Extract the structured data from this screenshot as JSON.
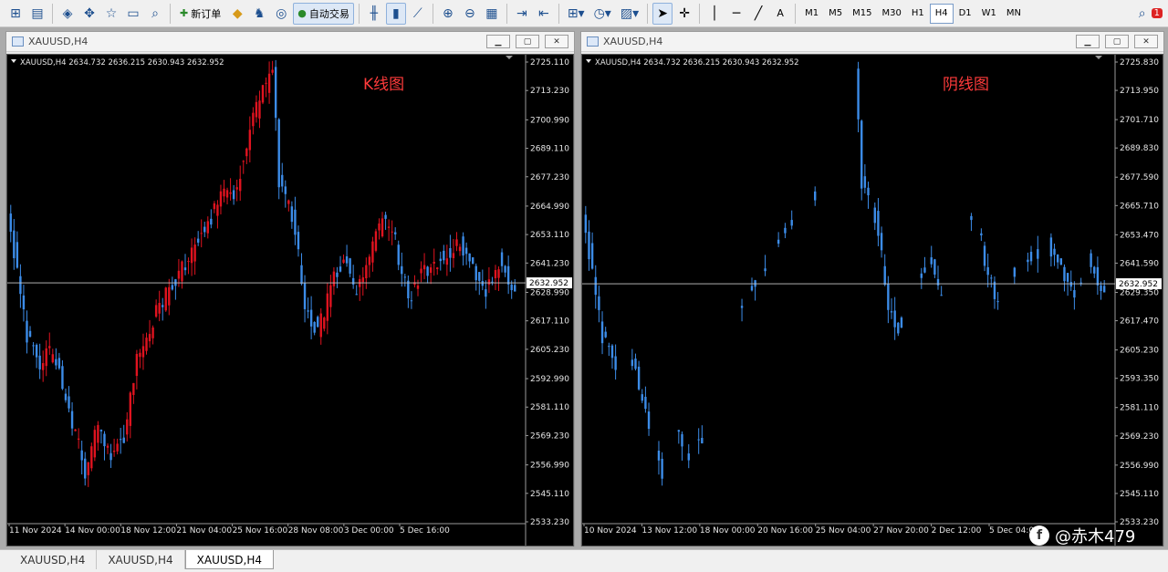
{
  "toolbar": {
    "new_order_label": "新订单",
    "auto_trading_label": "自动交易",
    "timeframes": [
      "M1",
      "M5",
      "M15",
      "M30",
      "H1",
      "H4",
      "D1",
      "W1",
      "MN"
    ],
    "active_timeframe": "H4",
    "alert_count": "1"
  },
  "windows": [
    {
      "title": "XAUUSD,H4",
      "ohlc_text": "XAUUSD,H4  2634.732 2636.215 2630.943 2632.952",
      "annotation": "K线图",
      "annotation_color": "#ff3b3b",
      "current_price": "2632.952",
      "bull_color": "#e0131f",
      "bear_color": "#3c8ce8"
    },
    {
      "title": "XAUUSD,H4",
      "ohlc_text": "XAUUSD,H4  2634.732 2636.215 2630.943 2632.952",
      "annotation": "阴线图",
      "annotation_color": "#ff3b3b",
      "current_price": "2632.952",
      "bull_color": "#000000",
      "bear_color": "#3c8ce8"
    }
  ],
  "chart_data": [
    {
      "type": "candlestick",
      "symbol": "XAUUSD",
      "timeframe": "H4",
      "y_ticks": [
        2725.11,
        2713.23,
        2700.99,
        2689.11,
        2677.23,
        2664.99,
        2653.11,
        2641.23,
        2628.99,
        2617.11,
        2605.23,
        2592.99,
        2581.11,
        2569.23,
        2556.99,
        2545.11,
        2533.23
      ],
      "ylim": [
        2533.23,
        2725.11
      ],
      "x_ticks": [
        "11 Nov 2024",
        "14 Nov 00:00",
        "18 Nov 12:00",
        "21 Nov 04:00",
        "25 Nov 16:00",
        "28 Nov 08:00",
        "3 Dec 00:00",
        "5 Dec 16:00"
      ],
      "current_price": 2632.952
    },
    {
      "type": "candlestick",
      "symbol": "XAUUSD",
      "timeframe": "H4",
      "y_ticks": [
        2725.83,
        2713.95,
        2701.71,
        2689.83,
        2677.59,
        2665.71,
        2653.47,
        2641.59,
        2629.35,
        2617.47,
        2605.23,
        2593.35,
        2581.11,
        2569.23,
        2556.99,
        2545.11,
        2533.23
      ],
      "ylim": [
        2533.23,
        2725.83
      ],
      "x_ticks": [
        "10 Nov 2024",
        "13 Nov 12:00",
        "18 Nov 00:00",
        "20 Nov 16:00",
        "25 Nov 04:00",
        "27 Nov 20:00",
        "2 Dec 12:00",
        "5 Dec 04:00"
      ],
      "current_price": 2632.952,
      "note": "bullish candles hidden"
    }
  ],
  "bottom_tabs": [
    "XAUUSD,H4",
    "XAUUSD,H4",
    "XAUUSD,H4"
  ],
  "watermark": "@赤木479"
}
